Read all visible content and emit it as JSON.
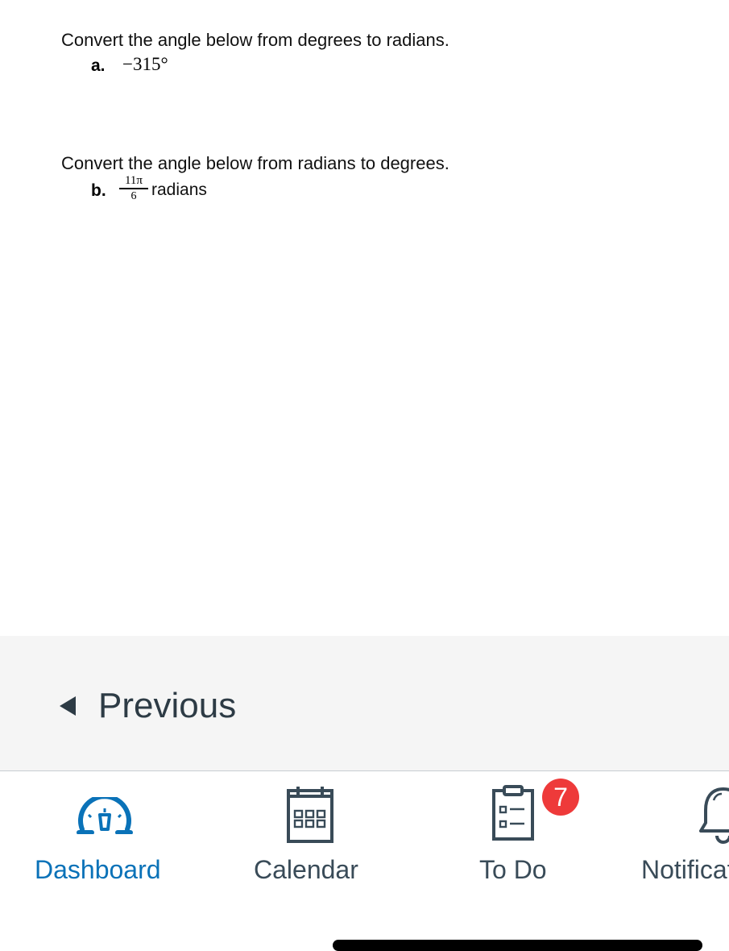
{
  "questions": {
    "q1": {
      "heading": "Convert the angle below from degrees to radians.",
      "label": "a.",
      "value": "−315°"
    },
    "q2": {
      "heading": "Convert the angle below from radians to degrees.",
      "label": "b.",
      "numerator": "11π",
      "denominator": "6",
      "unit": "radians"
    }
  },
  "nav": {
    "previous_label": "Previous"
  },
  "tabbar": {
    "active_color": "#0a72b8",
    "inactive_color": "#394b58",
    "tabs": [
      {
        "label": "Dashboard",
        "icon": "dashboard-gauge-icon"
      },
      {
        "label": "Calendar",
        "icon": "calendar-icon"
      },
      {
        "label": "To Do",
        "icon": "clipboard-checklist-icon",
        "badge": "7"
      },
      {
        "label": "Notifications",
        "icon": "bell-icon"
      }
    ]
  }
}
